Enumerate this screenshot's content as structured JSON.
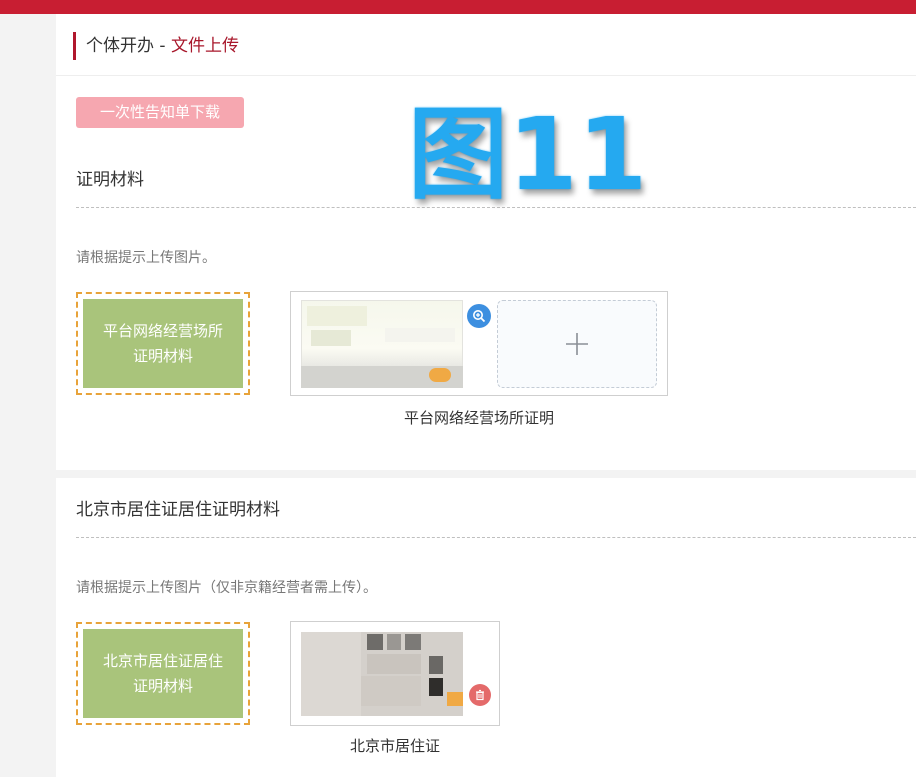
{
  "breadcrumb": {
    "parent": "个体开办",
    "separator": "-",
    "current": "文件上传"
  },
  "notice_button": {
    "label": "一次性告知单下载"
  },
  "watermark": {
    "text": "图11"
  },
  "sections": [
    {
      "title": "证明材料",
      "hint": "请根据提示上传图片。",
      "label_card": {
        "line1": "平台网络经营场所",
        "line2": "证明材料"
      },
      "caption": "平台网络经营场所证明"
    },
    {
      "title": "北京市居住证居住证明材料",
      "hint": "请根据提示上传图片（仅非京籍经营者需上传）。",
      "label_card": {
        "line1": "北京市居住证居住",
        "line2": "证明材料"
      },
      "caption": "北京市居住证"
    }
  ],
  "icons": {
    "zoom": "zoom-in-icon",
    "delete": "trash-icon",
    "add": "plus-icon"
  },
  "colors": {
    "brand_red": "#c81e32",
    "title_accent": "#b0172d",
    "breadcrumb_current": "#a8172b",
    "notice_button_bg": "#f6a7b0",
    "label_card_bg": "#a9c47b",
    "label_card_border": "#e8a33a",
    "zoom_icon": "#3d8fe0",
    "delete_icon": "#e46a6a",
    "watermark": "#25a9f0"
  }
}
